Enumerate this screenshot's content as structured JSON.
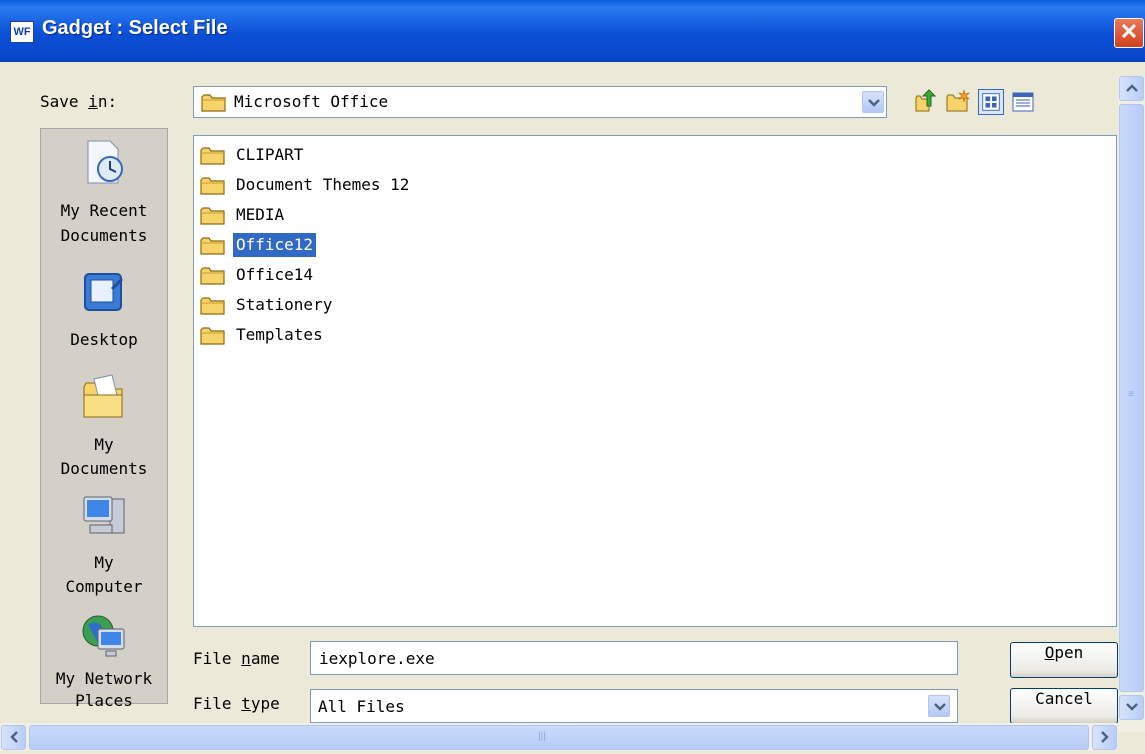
{
  "window": {
    "app_icon_text": "WF",
    "title": "Gadget : Select File",
    "close_glyph": "✕"
  },
  "save_in": {
    "label_pre": "Save ",
    "label_accel": "i",
    "label_post": "n:",
    "value": "Microsoft Office"
  },
  "toolbar": {
    "icons": [
      "up-one-level-icon",
      "new-folder-icon",
      "thumbnails-view-icon",
      "list-view-icon"
    ]
  },
  "places": [
    {
      "label_1": "My Recent",
      "label_2": "Documents",
      "icon": "recent-documents-icon"
    },
    {
      "label_1": "Desktop",
      "label_2": "",
      "icon": "desktop-icon"
    },
    {
      "label_1": "My",
      "label_2": "Documents",
      "icon": "my-documents-icon"
    },
    {
      "label_1": "My",
      "label_2": "Computer",
      "icon": "my-computer-icon"
    },
    {
      "label_1": "My Network",
      "label_2": "Places",
      "icon": "network-places-icon"
    }
  ],
  "files": [
    {
      "name": "CLIPART",
      "selected": false
    },
    {
      "name": "Document Themes 12",
      "selected": false
    },
    {
      "name": "MEDIA",
      "selected": false
    },
    {
      "name": "Office12",
      "selected": true
    },
    {
      "name": "Office14",
      "selected": false
    },
    {
      "name": "Stationery",
      "selected": false
    },
    {
      "name": "Templates",
      "selected": false
    }
  ],
  "file_name": {
    "label_pre": "File ",
    "label_accel": "n",
    "label_post": "ame",
    "value": "iexplore.exe"
  },
  "file_type": {
    "label_pre": "File ",
    "label_accel": "t",
    "label_post": "ype",
    "value": "All Files"
  },
  "buttons": {
    "open_accel": "O",
    "open_rest": "pen",
    "cancel": "Cancel"
  },
  "colors": {
    "title_blue": "#0B4FD6",
    "selection": "#316AC5",
    "dialog_bg": "#ECE9D8"
  }
}
